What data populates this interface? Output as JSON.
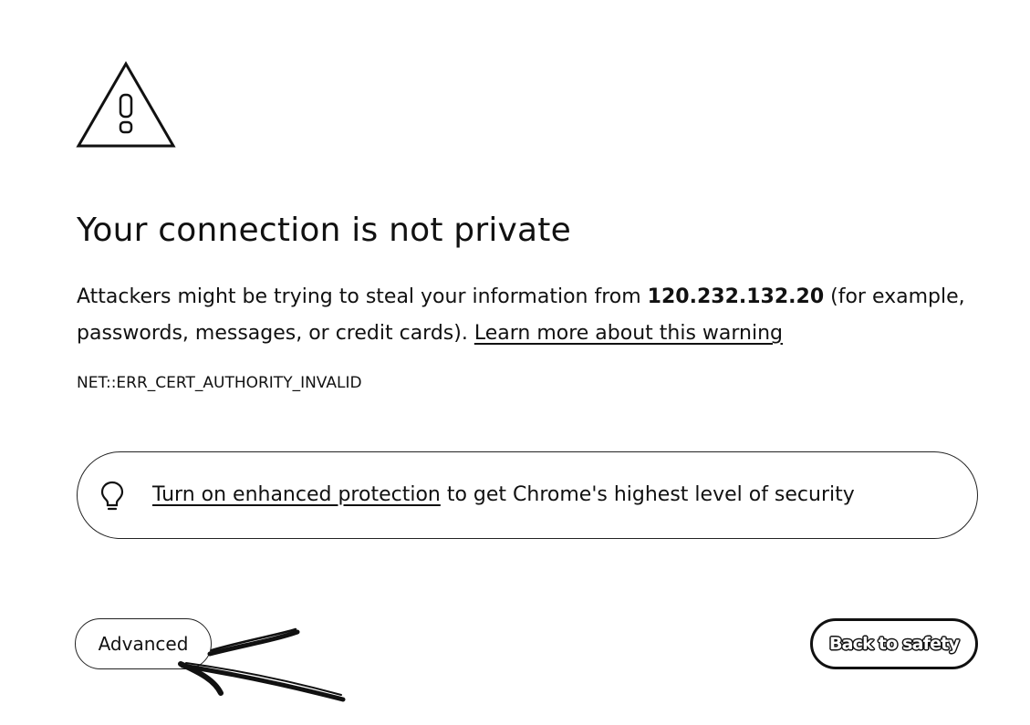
{
  "page": {
    "title": "Your connection is not private",
    "description": {
      "before_host": "Attackers might be trying to steal your information from ",
      "host": "120.232.132.20",
      "after_host": " (for example, passwords, messages, or credit cards). ",
      "learn_more_link": "Learn more about this warning"
    },
    "error_code": "NET::ERR_CERT_AUTHORITY_INVALID",
    "enhanced_protection": {
      "icon": "lightbulb-icon",
      "link_text": "Turn on enhanced protection",
      "rest_text": " to get Chrome's highest level of security"
    },
    "buttons": {
      "advanced_label": "Advanced",
      "back_to_safety_label": "Back to safety"
    },
    "icons": {
      "warning": "warning-triangle-icon"
    }
  }
}
